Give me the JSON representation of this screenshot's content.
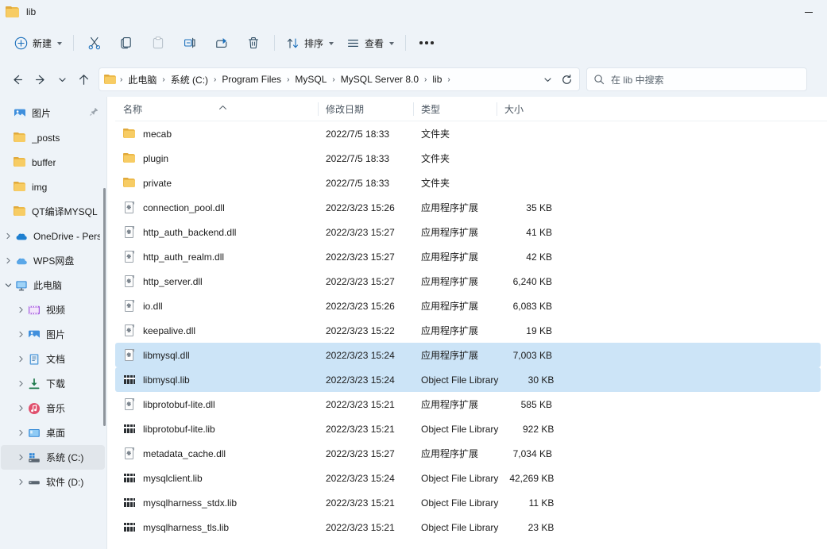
{
  "window": {
    "title": "lib",
    "folder_icon": "folder-icon",
    "controls": [
      {
        "name": "minimize-button",
        "glyph": "minimize-icon"
      }
    ]
  },
  "toolbar": {
    "new_label": "新建",
    "new_icon": "plus-circle-icon",
    "items": [
      {
        "name": "cut-button",
        "icon": "scissors-icon",
        "label": ""
      },
      {
        "name": "copy-button",
        "icon": "copy-icon",
        "label": ""
      },
      {
        "name": "paste-button",
        "icon": "paste-icon",
        "label": ""
      },
      {
        "name": "rename-button",
        "icon": "rename-icon",
        "label": ""
      },
      {
        "name": "share-button",
        "icon": "share-icon",
        "label": ""
      },
      {
        "name": "delete-button",
        "icon": "trash-icon",
        "label": ""
      }
    ],
    "sort_label": "排序",
    "sort_icon": "sort-arrows-icon",
    "view_label": "查看",
    "view_icon": "list-lines-icon",
    "more_label": "…",
    "more_icon": "ellipsis-icon"
  },
  "addressbar": {
    "back_icon": "arrow-left-icon",
    "forward_icon": "arrow-right-icon",
    "recent_icon": "chevron-down-icon",
    "up_icon": "arrow-up-icon",
    "breadcrumb": [
      "此电脑",
      "系统 (C:)",
      "Program Files",
      "MySQL",
      "MySQL Server 8.0",
      "lib"
    ],
    "separator": "›",
    "dropdown_icon": "chevron-down-icon",
    "refresh_icon": "refresh-icon"
  },
  "search": {
    "placeholder": "在 lib 中搜索",
    "icon": "search-icon"
  },
  "sidebar": {
    "items": [
      {
        "label": "图片",
        "icon": "pictures-icon",
        "depth": 1,
        "expand": "none",
        "pinned": true,
        "selected": false
      },
      {
        "label": "_posts",
        "icon": "folder-icon",
        "depth": 1,
        "expand": "none",
        "pinned": false,
        "selected": false
      },
      {
        "label": "buffer",
        "icon": "folder-icon",
        "depth": 1,
        "expand": "none",
        "pinned": false,
        "selected": false
      },
      {
        "label": "img",
        "icon": "folder-icon",
        "depth": 1,
        "expand": "none",
        "pinned": false,
        "selected": false
      },
      {
        "label": "QT编译MYSQL",
        "icon": "folder-icon",
        "depth": 1,
        "expand": "none",
        "pinned": false,
        "selected": false
      },
      {
        "label": "OneDrive - Pers",
        "icon": "onedrive-icon",
        "depth": 0,
        "expand": "collapsed",
        "pinned": false,
        "selected": false
      },
      {
        "label": "WPS网盘",
        "icon": "wps-cloud-icon",
        "depth": 0,
        "expand": "collapsed",
        "pinned": false,
        "selected": false
      },
      {
        "label": "此电脑",
        "icon": "pc-icon",
        "depth": 0,
        "expand": "expanded",
        "pinned": false,
        "selected": false
      },
      {
        "label": "视频",
        "icon": "videos-icon",
        "depth": 1,
        "expand": "collapsed",
        "pinned": false,
        "selected": false
      },
      {
        "label": "图片",
        "icon": "pictures-icon",
        "depth": 1,
        "expand": "collapsed",
        "pinned": false,
        "selected": false
      },
      {
        "label": "文档",
        "icon": "documents-icon",
        "depth": 1,
        "expand": "collapsed",
        "pinned": false,
        "selected": false
      },
      {
        "label": "下载",
        "icon": "downloads-icon",
        "depth": 1,
        "expand": "collapsed",
        "pinned": false,
        "selected": false
      },
      {
        "label": "音乐",
        "icon": "music-icon",
        "depth": 1,
        "expand": "collapsed",
        "pinned": false,
        "selected": false
      },
      {
        "label": "桌面",
        "icon": "desktop-icon",
        "depth": 1,
        "expand": "collapsed",
        "pinned": false,
        "selected": false
      },
      {
        "label": "系统 (C:)",
        "icon": "os-drive-icon",
        "depth": 1,
        "expand": "collapsed",
        "pinned": false,
        "selected": true
      },
      {
        "label": "软件 (D:)",
        "icon": "drive-icon",
        "depth": 1,
        "expand": "collapsed",
        "pinned": false,
        "selected": false
      }
    ]
  },
  "filelist": {
    "columns": [
      {
        "label": "名称",
        "key": "name",
        "sorted": "asc"
      },
      {
        "label": "修改日期",
        "key": "date",
        "sorted": ""
      },
      {
        "label": "类型",
        "key": "type",
        "sorted": ""
      },
      {
        "label": "大小",
        "key": "size",
        "sorted": ""
      }
    ],
    "rows": [
      {
        "name": "mecab",
        "date": "2022/7/5 18:33",
        "type": "文件夹",
        "size": "",
        "icon": "folder-icon",
        "selected": false
      },
      {
        "name": "plugin",
        "date": "2022/7/5 18:33",
        "type": "文件夹",
        "size": "",
        "icon": "folder-icon",
        "selected": false
      },
      {
        "name": "private",
        "date": "2022/7/5 18:33",
        "type": "文件夹",
        "size": "",
        "icon": "folder-icon",
        "selected": false
      },
      {
        "name": "connection_pool.dll",
        "date": "2022/3/23 15:26",
        "type": "应用程序扩展",
        "size": "35 KB",
        "icon": "dll-icon",
        "selected": false
      },
      {
        "name": "http_auth_backend.dll",
        "date": "2022/3/23 15:27",
        "type": "应用程序扩展",
        "size": "41 KB",
        "icon": "dll-icon",
        "selected": false
      },
      {
        "name": "http_auth_realm.dll",
        "date": "2022/3/23 15:27",
        "type": "应用程序扩展",
        "size": "42 KB",
        "icon": "dll-icon",
        "selected": false
      },
      {
        "name": "http_server.dll",
        "date": "2022/3/23 15:27",
        "type": "应用程序扩展",
        "size": "6,240 KB",
        "icon": "dll-icon",
        "selected": false
      },
      {
        "name": "io.dll",
        "date": "2022/3/23 15:26",
        "type": "应用程序扩展",
        "size": "6,083 KB",
        "icon": "dll-icon",
        "selected": false
      },
      {
        "name": "keepalive.dll",
        "date": "2022/3/23 15:22",
        "type": "应用程序扩展",
        "size": "19 KB",
        "icon": "dll-icon",
        "selected": false
      },
      {
        "name": "libmysql.dll",
        "date": "2022/3/23 15:24",
        "type": "应用程序扩展",
        "size": "7,003 KB",
        "icon": "dll-icon",
        "selected": true
      },
      {
        "name": "libmysql.lib",
        "date": "2022/3/23 15:24",
        "type": "Object File Library",
        "size": "30 KB",
        "icon": "lib-icon",
        "selected": true
      },
      {
        "name": "libprotobuf-lite.dll",
        "date": "2022/3/23 15:21",
        "type": "应用程序扩展",
        "size": "585 KB",
        "icon": "dll-icon",
        "selected": false
      },
      {
        "name": "libprotobuf-lite.lib",
        "date": "2022/3/23 15:21",
        "type": "Object File Library",
        "size": "922 KB",
        "icon": "lib-icon",
        "selected": false
      },
      {
        "name": "metadata_cache.dll",
        "date": "2022/3/23 15:27",
        "type": "应用程序扩展",
        "size": "7,034 KB",
        "icon": "dll-icon",
        "selected": false
      },
      {
        "name": "mysqlclient.lib",
        "date": "2022/3/23 15:24",
        "type": "Object File Library",
        "size": "42,269 KB",
        "icon": "lib-icon",
        "selected": false
      },
      {
        "name": "mysqlharness_stdx.lib",
        "date": "2022/3/23 15:21",
        "type": "Object File Library",
        "size": "11 KB",
        "icon": "lib-icon",
        "selected": false
      },
      {
        "name": "mysqlharness_tls.lib",
        "date": "2022/3/23 15:21",
        "type": "Object File Library",
        "size": "23 KB",
        "icon": "lib-icon",
        "selected": false
      }
    ]
  },
  "colors": {
    "chrome": "#eef3f8",
    "selection": "#cce4f7",
    "accent": "#0f6cbd",
    "folder": "#f7cc64"
  }
}
